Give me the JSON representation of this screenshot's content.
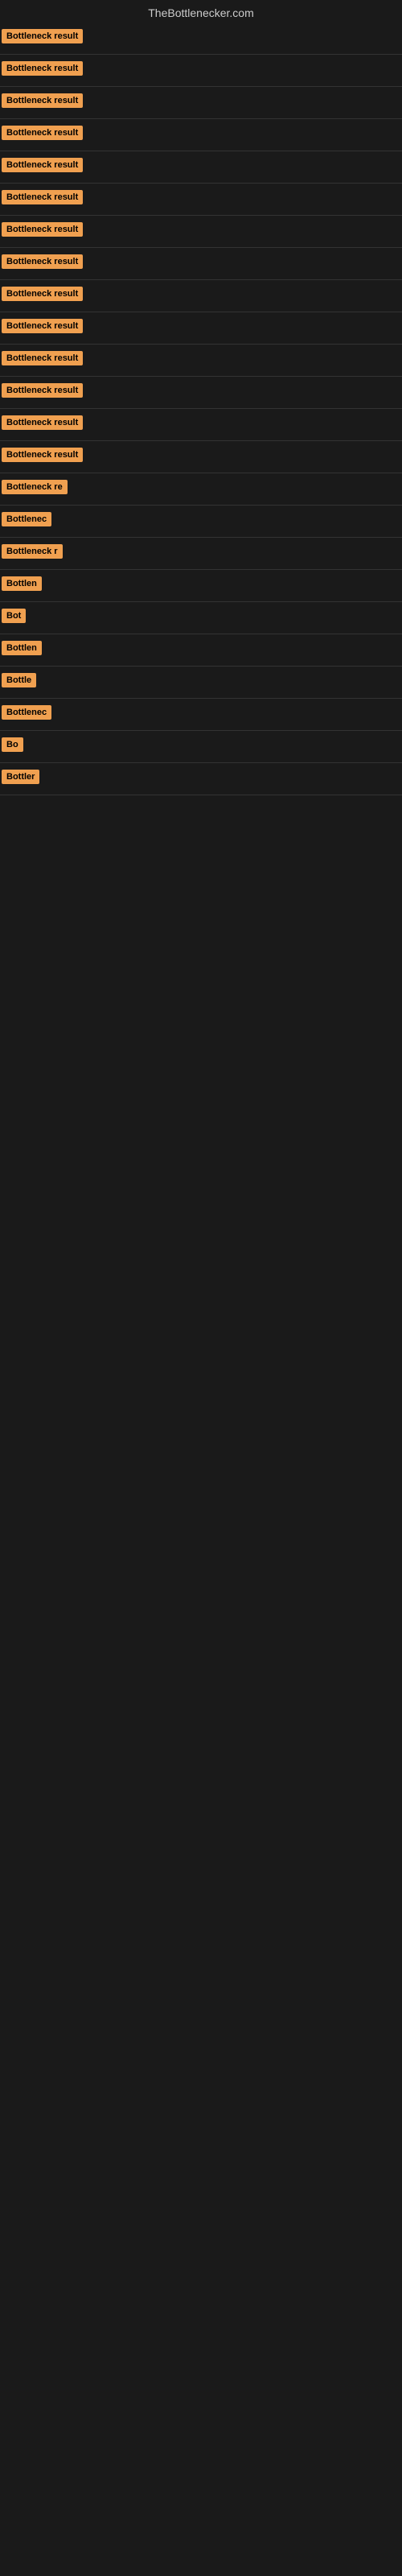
{
  "header": {
    "title": "TheBottlenecker.com"
  },
  "items": [
    {
      "id": 1,
      "label": "Bottleneck result",
      "width": 120
    },
    {
      "id": 2,
      "label": "Bottleneck result",
      "width": 120
    },
    {
      "id": 3,
      "label": "Bottleneck result",
      "width": 120
    },
    {
      "id": 4,
      "label": "Bottleneck result",
      "width": 120
    },
    {
      "id": 5,
      "label": "Bottleneck result",
      "width": 120
    },
    {
      "id": 6,
      "label": "Bottleneck result",
      "width": 120
    },
    {
      "id": 7,
      "label": "Bottleneck result",
      "width": 120
    },
    {
      "id": 8,
      "label": "Bottleneck result",
      "width": 120
    },
    {
      "id": 9,
      "label": "Bottleneck result",
      "width": 120
    },
    {
      "id": 10,
      "label": "Bottleneck result",
      "width": 120
    },
    {
      "id": 11,
      "label": "Bottleneck result",
      "width": 120
    },
    {
      "id": 12,
      "label": "Bottleneck result",
      "width": 120
    },
    {
      "id": 13,
      "label": "Bottleneck result",
      "width": 120
    },
    {
      "id": 14,
      "label": "Bottleneck result",
      "width": 120
    },
    {
      "id": 15,
      "label": "Bottleneck re",
      "width": 100
    },
    {
      "id": 16,
      "label": "Bottlenec",
      "width": 80
    },
    {
      "id": 17,
      "label": "Bottleneck r",
      "width": 88
    },
    {
      "id": 18,
      "label": "Bottlen",
      "width": 62
    },
    {
      "id": 19,
      "label": "Bot",
      "width": 36
    },
    {
      "id": 20,
      "label": "Bottlen",
      "width": 62
    },
    {
      "id": 21,
      "label": "Bottle",
      "width": 54
    },
    {
      "id": 22,
      "label": "Bottlenec",
      "width": 80
    },
    {
      "id": 23,
      "label": "Bo",
      "width": 28
    },
    {
      "id": 24,
      "label": "Bottler",
      "width": 58
    }
  ],
  "colors": {
    "badge_bg": "#f0a050",
    "badge_text": "#000000",
    "page_bg": "#1a1a1a",
    "header_text": "#cccccc"
  }
}
